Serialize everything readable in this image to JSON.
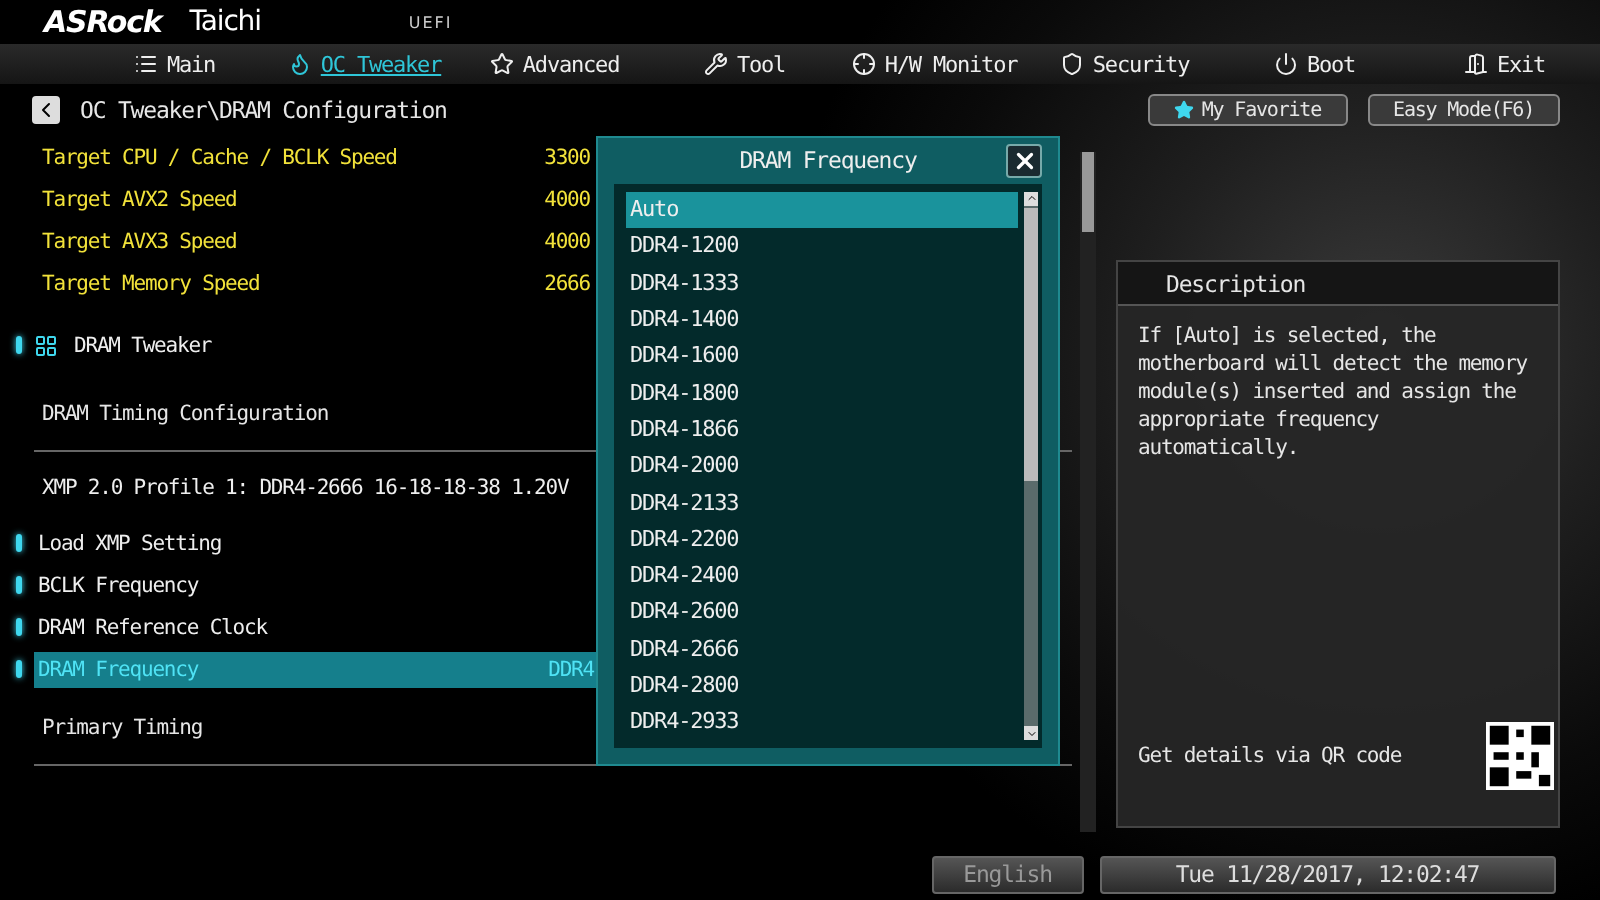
{
  "header": {
    "brand": "ASRock",
    "model": "Taichi",
    "firmware": "UEFI"
  },
  "tabs": [
    {
      "label": "Main",
      "selected": false
    },
    {
      "label": "OC Tweaker",
      "selected": true
    },
    {
      "label": "Advanced",
      "selected": false
    },
    {
      "label": "Tool",
      "selected": false
    },
    {
      "label": "H/W Monitor",
      "selected": false
    },
    {
      "label": "Security",
      "selected": false
    },
    {
      "label": "Boot",
      "selected": false
    },
    {
      "label": "Exit",
      "selected": false
    }
  ],
  "breadcrumb": "OC Tweaker\\DRAM Configuration",
  "shortcuts": [
    "My Favorite",
    "Easy Mode(F6)"
  ],
  "settings": [
    {
      "kind": "info",
      "label": "Target CPU / Cache / BCLK Speed",
      "value": "3300"
    },
    {
      "kind": "info",
      "label": "Target AVX2 Speed",
      "value": "4000"
    },
    {
      "kind": "info",
      "label": "Target AVX3 Speed",
      "value": "4000"
    },
    {
      "kind": "info",
      "label": "Target Memory Speed",
      "value": "2666"
    },
    {
      "kind": "folder",
      "label": "DRAM Tweaker"
    },
    {
      "kind": "heading",
      "label": "DRAM Timing Configuration"
    },
    {
      "kind": "note",
      "label": "XMP 2.0 Profile 1: DDR4-2666 16-18-18-38 1.20V"
    },
    {
      "kind": "option",
      "label": "Load XMP Setting",
      "selected": false
    },
    {
      "kind": "option",
      "label": "BCLK Frequency",
      "selected": false
    },
    {
      "kind": "option",
      "label": "DRAM Reference Clock",
      "selected": false
    },
    {
      "kind": "option",
      "label": "DRAM Frequency",
      "value": "DDR4",
      "selected": true
    },
    {
      "kind": "heading",
      "label": "Primary Timing"
    }
  ],
  "popup": {
    "title": "DRAM Frequency",
    "options": [
      {
        "label": "Auto",
        "selected": true
      },
      {
        "label": "DDR4-1200",
        "selected": false
      },
      {
        "label": "DDR4-1333",
        "selected": false
      },
      {
        "label": "DDR4-1400",
        "selected": false
      },
      {
        "label": "DDR4-1600",
        "selected": false
      },
      {
        "label": "DDR4-1800",
        "selected": false
      },
      {
        "label": "DDR4-1866",
        "selected": false
      },
      {
        "label": "DDR4-2000",
        "selected": false
      },
      {
        "label": "DDR4-2133",
        "selected": false
      },
      {
        "label": "DDR4-2200",
        "selected": false
      },
      {
        "label": "DDR4-2400",
        "selected": false
      },
      {
        "label": "DDR4-2600",
        "selected": false
      },
      {
        "label": "DDR4-2666",
        "selected": false
      },
      {
        "label": "DDR4-2800",
        "selected": false
      },
      {
        "label": "DDR4-2933",
        "selected": false
      }
    ]
  },
  "description": {
    "title": "Description",
    "text": "If [Auto] is selected, the motherboard will detect the memory module(s) inserted and assign the appropriate frequency automatically.",
    "qr_caption": "Get details via QR code"
  },
  "footer": {
    "language": "English",
    "datetime": "Tue 11/28/2017, 12:02:47"
  }
}
